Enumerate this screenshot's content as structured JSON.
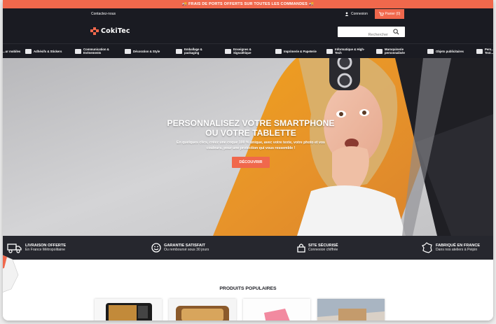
{
  "promo_bar": {
    "text": "FRAIS DE PORTS OFFERTS SUR TOUTES LES COMMANDES",
    "emoji": "🚚"
  },
  "top_bar": {
    "contact": "Contactez-nous",
    "login": "Connexion",
    "cart": "Panier (0)"
  },
  "header": {
    "logo_text": "CokiTec",
    "search_placeholder": "Rechercher"
  },
  "nav": [
    {
      "label": "...ur mobiles"
    },
    {
      "label": "Adhésifs & Stickers"
    },
    {
      "label": "Communication & Evénements"
    },
    {
      "label": "Décoration & Style"
    },
    {
      "label": "Emballage & packaging"
    },
    {
      "label": "Enseignes & Signalétique"
    },
    {
      "label": "Imprimerie & Papeterie"
    },
    {
      "label": "Informatique & High-Tech"
    },
    {
      "label": "Maroquinerie personnalisée"
    },
    {
      "label": "Objets publicitaires"
    },
    {
      "label": "Pers... Text..."
    }
  ],
  "hero": {
    "title_line1": "PERSONNALISEZ VOTRE SMARTPHONE",
    "title_line2": "OU VOTRE TABLETTE",
    "subtitle_line1": "En quelques clics, créez une coque 100 % unique, avec votre texte, votre photo et vos",
    "subtitle_line2": "couleurs, pour une protection qui vous ressemble !",
    "cta": "DÉCOUVRIR"
  },
  "features": [
    {
      "title": "LIVRAISON OFFERTE",
      "subtitle": "En France Métropolitaine",
      "icon": "truck-icon"
    },
    {
      "title": "GARANTIE SATISFAIT",
      "subtitle": "Ou remboursé sous 30 jours",
      "icon": "smile-icon"
    },
    {
      "title": "SITE SÉCURISÉ",
      "subtitle": "Connexion chiffrée",
      "icon": "lock-icon"
    },
    {
      "title": "FABRIQUÉ EN FRANCE",
      "subtitle": "Dans nos ateliers à Peipin",
      "icon": "france-map-icon"
    }
  ],
  "popular": {
    "title": "PRODUITS POPULAIRES"
  },
  "colors": {
    "accent": "#f0684c",
    "dark": "#1a1b22",
    "features_bg": "#26272e"
  }
}
